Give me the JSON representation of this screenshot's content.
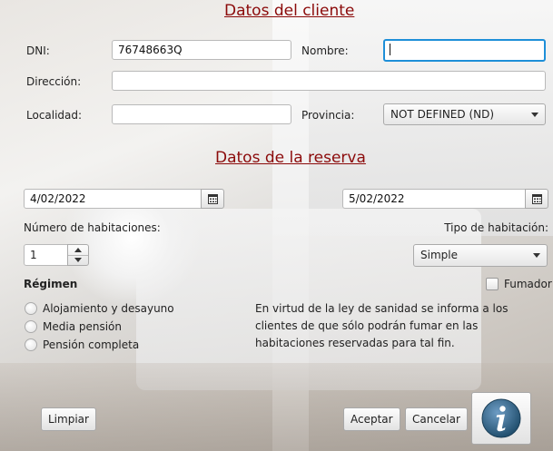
{
  "cliente": {
    "title": "Datos del cliente",
    "dni_label": "DNI:",
    "dni_value": "76748663Q",
    "nombre_label": "Nombre:",
    "nombre_value": "",
    "direccion_label": "Dirección:",
    "direccion_value": "",
    "localidad_label": "Localidad:",
    "localidad_value": "",
    "provincia_label": "Provincia:",
    "provincia_value": "NOT DEFINED (ND)"
  },
  "reserva": {
    "title": "Datos de la reserva",
    "fecha_entrada": "4/02/2022",
    "fecha_salida": "5/02/2022",
    "habitaciones_label": "Número de habitaciones:",
    "habitaciones_value": "1",
    "tipo_label": "Tipo de habitación:",
    "tipo_value": "Simple",
    "regimen_label": "Régimen",
    "regimen_options": [
      "Alojamiento y desayuno",
      "Media pensión",
      "Pensión completa"
    ],
    "fumador_label": "Fumador",
    "fumador_checked": false,
    "aviso": "En virtud de la ley de sanidad se informa a los clientes de que sólo podrán fumar en las habitaciones reservadas para tal fin."
  },
  "buttons": {
    "limpiar": "Limpiar",
    "aceptar": "Aceptar",
    "cancelar": "Cancelar",
    "info_icon": "info-icon"
  },
  "colors": {
    "heading": "#8b0a0a",
    "focus": "#1e8fd8",
    "info_icon": "#2e5f86"
  },
  "icons": {
    "calendar": "calendar-icon"
  }
}
